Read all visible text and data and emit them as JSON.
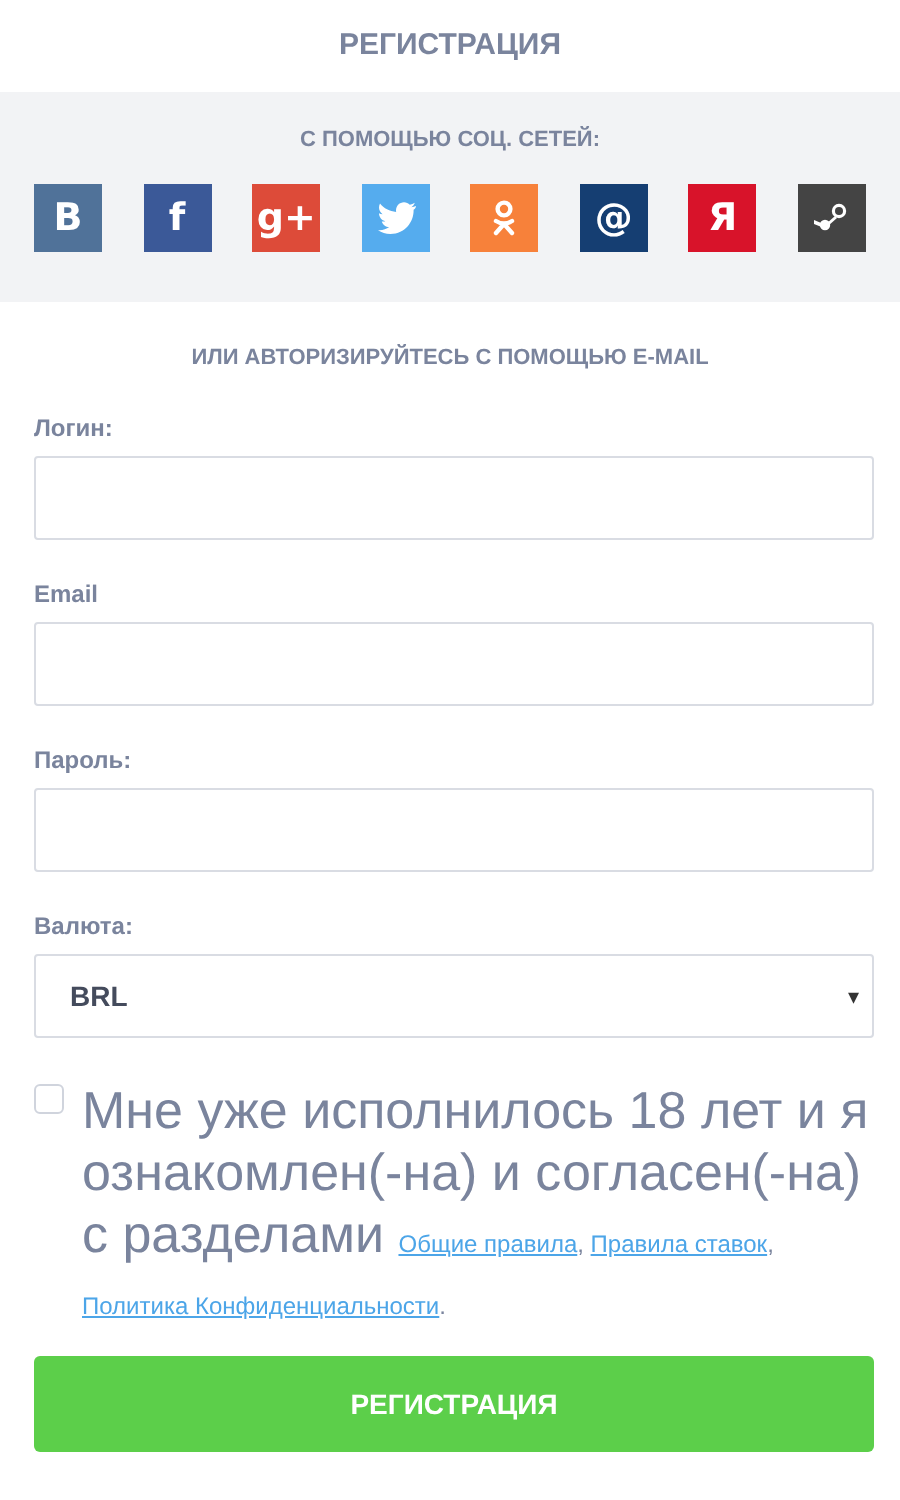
{
  "title": "РЕГИСТРАЦИЯ",
  "social": {
    "heading": "С ПОМОЩЬЮ СОЦ. СЕТЕЙ:",
    "items": [
      {
        "kind": "letter",
        "glyph": "B",
        "color": "#507299"
      },
      {
        "kind": "letter",
        "glyph": "f",
        "color": "#3b5998"
      },
      {
        "kind": "letter",
        "glyph": "g+",
        "color": "#dd4b39"
      },
      {
        "kind": "bird",
        "color": "#55acee"
      },
      {
        "kind": "ok",
        "color": "#f7813a"
      },
      {
        "kind": "letter",
        "glyph": "@",
        "color": "#153e72"
      },
      {
        "kind": "letter",
        "glyph": "Я",
        "color": "#d8132a"
      },
      {
        "kind": "steam",
        "color": "#444444"
      }
    ]
  },
  "email_heading": "ИЛИ АВТОРИЗИРУЙТЕСЬ С ПОМОЩЬЮ E-MAIL",
  "fields": [
    {
      "kind": "text",
      "label": "Логин:"
    },
    {
      "kind": "text",
      "label": "Email"
    },
    {
      "kind": "text",
      "label": "Пароль:"
    },
    {
      "kind": "select",
      "label": "Валюта:",
      "value": "BRL",
      "caret": "▾"
    }
  ],
  "agreement": {
    "checked": false,
    "text": "Мне уже исполнилось 18 лет и я ознакомлен(-на) и согласен(-на) с разделами",
    "links": [
      "Общие правила",
      "Правила ставок",
      "Политика Конфиденциальности"
    ],
    "separator": ",",
    "end": "."
  },
  "submit": "РЕГИСТРАЦИЯ"
}
